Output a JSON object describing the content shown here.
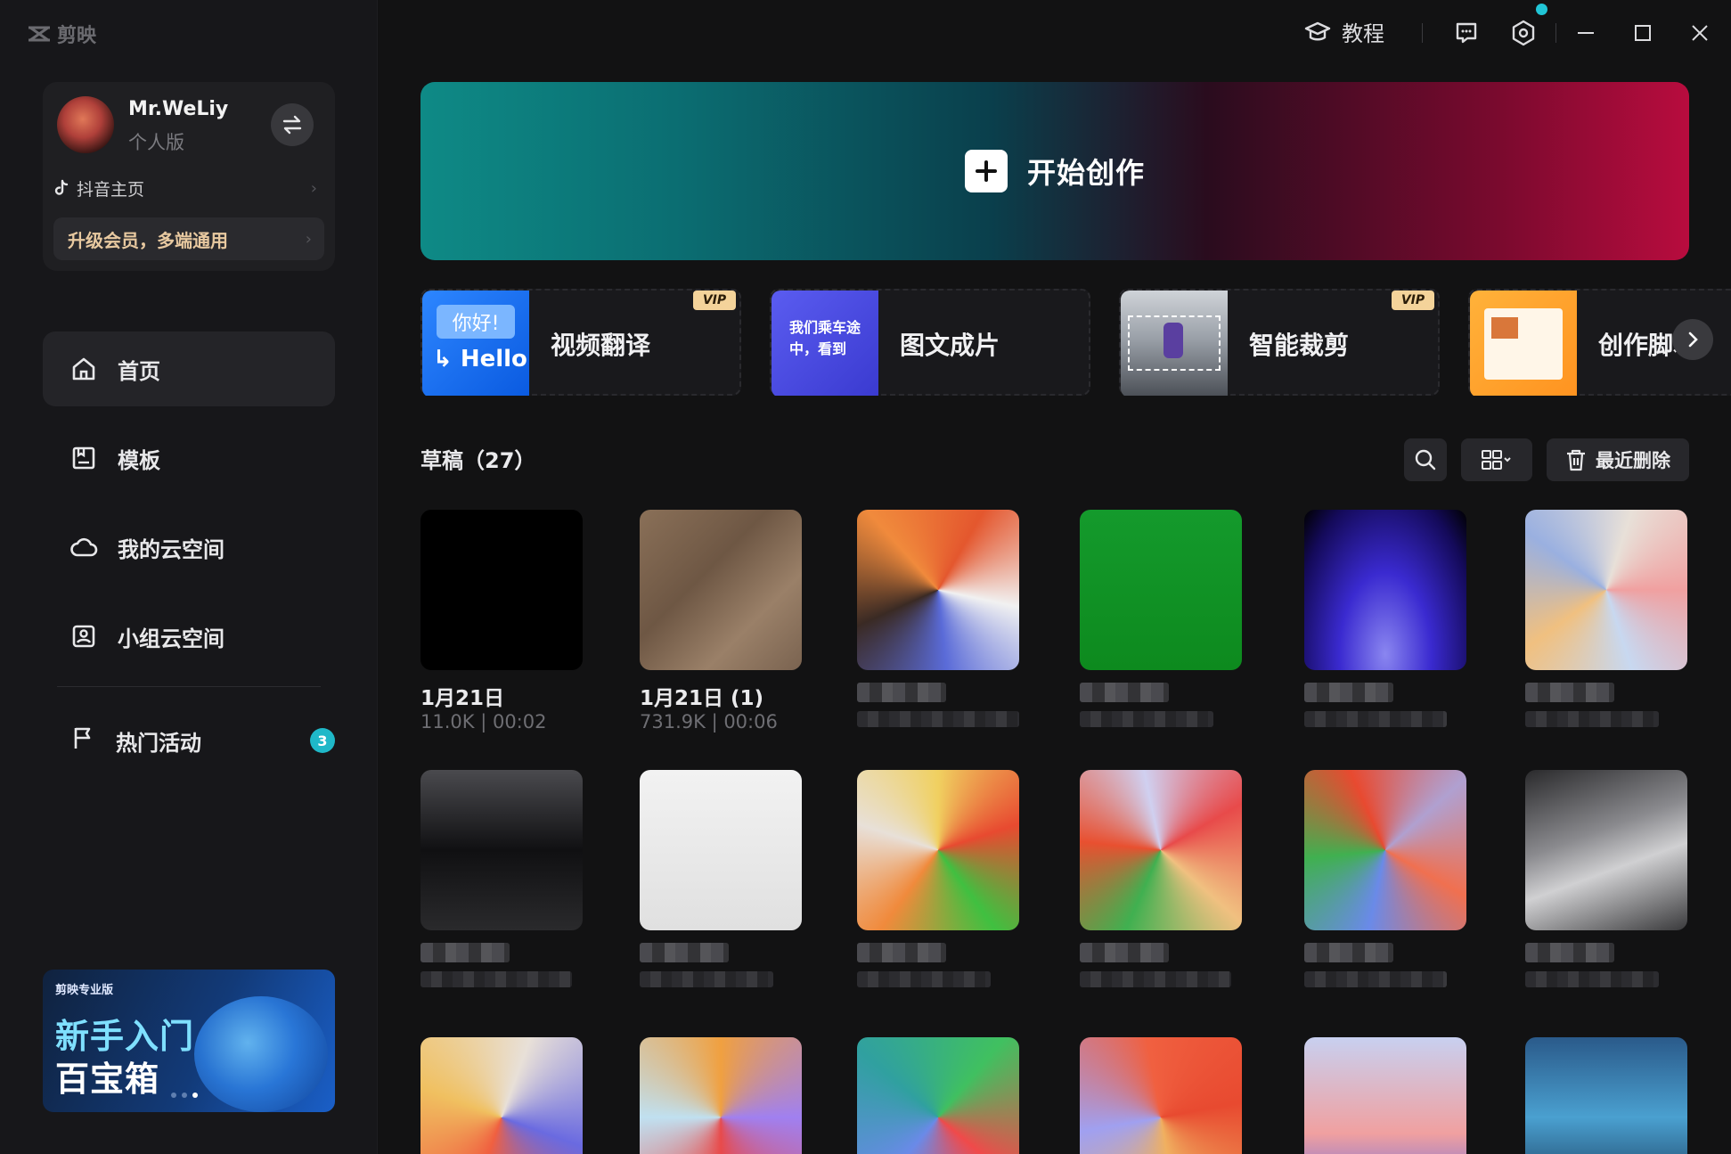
{
  "app": {
    "logo_text": "剪映"
  },
  "profile": {
    "username": "Mr.WeLiy",
    "plan": "个人版",
    "douyin_label": "抖音主页",
    "upgrade_label": "升级会员，多端通用"
  },
  "nav": {
    "items": [
      {
        "label": "首页",
        "icon": "home-icon"
      },
      {
        "label": "模板",
        "icon": "template-icon"
      },
      {
        "label": "我的云空间",
        "icon": "cloud-icon"
      },
      {
        "label": "小组云空间",
        "icon": "group-cloud-icon"
      }
    ],
    "hot_label": "热门活动",
    "hot_badge": "3"
  },
  "promo": {
    "tag": "剪映专业版",
    "line1": "新手入门",
    "line2": "百宝箱"
  },
  "titlebar": {
    "tutorial_label": "教程"
  },
  "hero": {
    "label": "开始创作"
  },
  "features": [
    {
      "label": "视频翻译",
      "vip": "VIP",
      "thumb_top": "你好!",
      "thumb_bottom": "Hello"
    },
    {
      "label": "图文成片",
      "vip": "",
      "thumb_text": "我们乘车途中，看到"
    },
    {
      "label": "智能裁剪",
      "vip": "VIP"
    },
    {
      "label": "创作脚本",
      "vip": ""
    }
  ],
  "drafts": {
    "title": "草稿（27）",
    "recent_delete_label": "最近删除",
    "items": [
      {
        "name": "1月21日",
        "meta": "11.0K | 00:02"
      },
      {
        "name": "1月21日 (1)",
        "meta": "731.9K | 00:06"
      }
    ]
  },
  "colors": {
    "accent": "#1fb8c8",
    "vip": "#f4d39a",
    "hero_left": "#0e8a86",
    "hero_right": "#b80c3e"
  }
}
